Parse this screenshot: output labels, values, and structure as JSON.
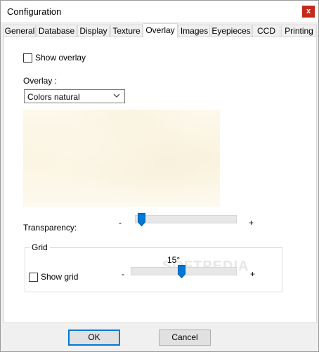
{
  "window": {
    "title": "Configuration",
    "close_label": "x"
  },
  "tabs": [
    {
      "label": "General"
    },
    {
      "label": "Database"
    },
    {
      "label": "Display"
    },
    {
      "label": "Texture"
    },
    {
      "label": "Overlay"
    },
    {
      "label": "Images"
    },
    {
      "label": "Eyepieces"
    },
    {
      "label": "CCD"
    },
    {
      "label": "Printing"
    }
  ],
  "active_tab": "Overlay",
  "overlay": {
    "show_overlay_label": "Show overlay",
    "show_overlay_checked": false,
    "overlay_label": "Overlay :",
    "overlay_selected": "Colors natural",
    "transparency_label": "Transparency:",
    "transparency_min": "-",
    "transparency_max": "+",
    "transparency_value": 0.03
  },
  "grid": {
    "title": "Grid",
    "show_grid_label": "Show grid",
    "show_grid_checked": false,
    "value_label": "15°",
    "min": "-",
    "max": "+",
    "value": 0.48
  },
  "watermark": "SOFTPEDIA",
  "buttons": {
    "ok": "OK",
    "cancel": "Cancel"
  }
}
